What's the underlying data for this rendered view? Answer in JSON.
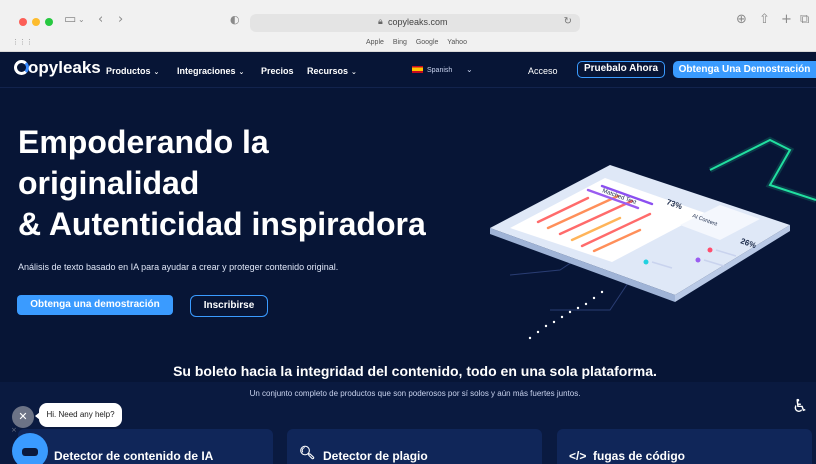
{
  "browser": {
    "url": "copyleaks.com",
    "favorites": [
      "Apple",
      "Bing",
      "Google",
      "Yahoo"
    ]
  },
  "nav": {
    "logo": "opyleaks",
    "items": [
      {
        "label": "Productos"
      },
      {
        "label": "Integraciones"
      },
      {
        "label": "Precios"
      },
      {
        "label": "Recursos"
      }
    ],
    "language": "Spanish",
    "login": "Acceso",
    "try_button": "Pruebalo Ahora",
    "demo_button": "Obtenga Una Demostración"
  },
  "hero": {
    "title_lines": [
      "Empoderando la",
      "originalidad",
      "& Autenticidad inspiradora"
    ],
    "subtitle": "Análisis de texto basado en IA para ayudar a crear y proteger contenido original.",
    "demo_button": "Obtenga una demostración",
    "signup_button": "Inscribirse"
  },
  "illustration": {
    "labels": [
      "Matched Text",
      "AI Content"
    ],
    "percent_1": "73%",
    "percent_2": "26%"
  },
  "section": {
    "title": "Su boleto hacia la integridad del contenido, todo en una sola plataforma.",
    "subtitle": "Un conjunto completo de productos que son poderosos por sí solos y aún más fuertes juntos."
  },
  "cards": [
    {
      "label": "Detector de contenido de IA"
    },
    {
      "label": "Detector de plagio"
    },
    {
      "label": "fugas de código",
      "icon": "</>"
    }
  ],
  "chat": {
    "message": "Hi. Need any help?"
  },
  "colors": {
    "background": "#071536",
    "accent": "#3a9bff",
    "neon": "#22e0a0"
  }
}
